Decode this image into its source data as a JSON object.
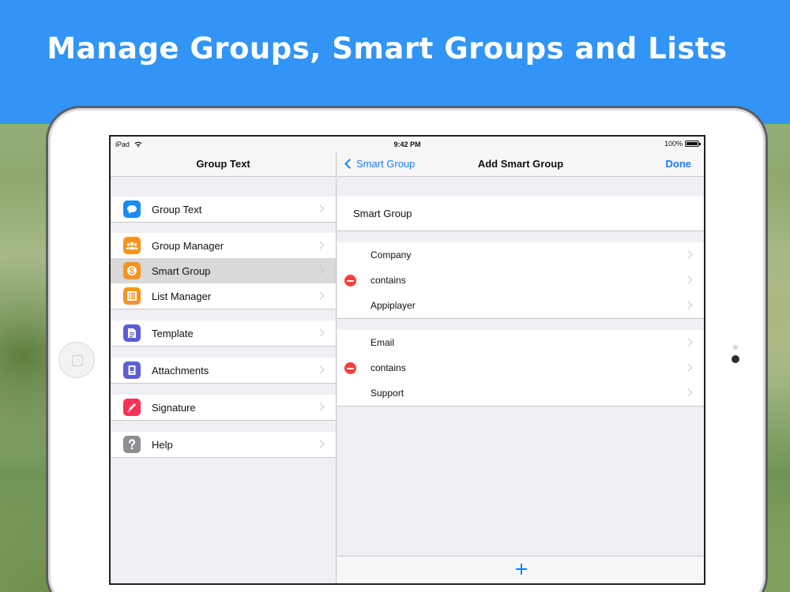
{
  "headline": "Manage Groups, Smart Groups and Lists",
  "status_bar": {
    "device": "iPad",
    "time": "9:42 PM",
    "battery": "100%"
  },
  "master": {
    "title": "Group Text",
    "sections": [
      [
        {
          "label": "Group Text",
          "icon": "chat-bubble-icon",
          "color": "#1a8cf2"
        }
      ],
      [
        {
          "label": "Group Manager",
          "icon": "people-icon",
          "color": "#f7941d"
        },
        {
          "label": "Smart Group",
          "icon": "smart-group-icon",
          "color": "#f7941d",
          "selected": true
        },
        {
          "label": "List Manager",
          "icon": "list-icon",
          "color": "#f7941d"
        }
      ],
      [
        {
          "label": "Template",
          "icon": "document-icon",
          "color": "#5c5ed6"
        }
      ],
      [
        {
          "label": "Attachments",
          "icon": "attachment-icon",
          "color": "#5c5ed6"
        }
      ],
      [
        {
          "label": "Signature",
          "icon": "pen-icon",
          "color": "#fc3158"
        }
      ],
      [
        {
          "label": "Help",
          "icon": "question-icon",
          "color": "#8e8e93"
        }
      ]
    ]
  },
  "detail": {
    "back_label": "Smart Group",
    "title": "Add Smart Group",
    "done_label": "Done",
    "name_field": "Smart Group",
    "rules": [
      {
        "field": "Company",
        "operator": "contains",
        "value": "Appiplayer"
      },
      {
        "field": "Email",
        "operator": "contains",
        "value": "Support"
      }
    ]
  },
  "colors": {
    "banner": "#3294f6",
    "accent": "#157efb",
    "delete": "#fc3d39"
  }
}
